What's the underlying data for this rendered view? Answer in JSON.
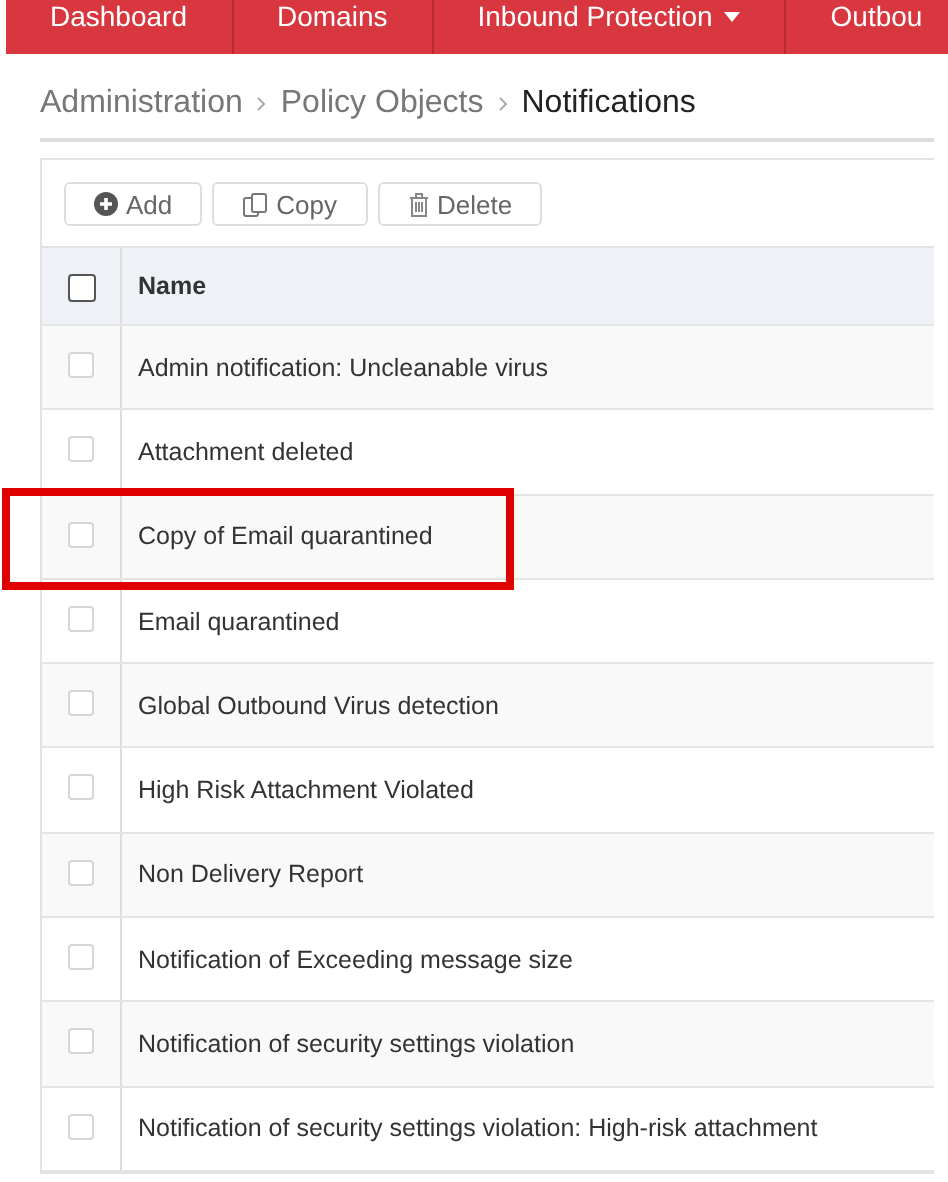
{
  "nav_tabs": [
    {
      "label": "Dashboard",
      "dropdown": false
    },
    {
      "label": "Domains",
      "dropdown": false
    },
    {
      "label": "Inbound Protection",
      "dropdown": true
    },
    {
      "label": "Outbou",
      "dropdown": false
    }
  ],
  "breadcrumb": [
    "Administration",
    "Policy Objects",
    "Notifications"
  ],
  "toolbar": [
    {
      "label": "Add",
      "kind": "add"
    },
    {
      "label": "Copy",
      "kind": "copy"
    },
    {
      "label": "Delete",
      "kind": "delete"
    }
  ],
  "table": {
    "columns": [
      "Name"
    ],
    "header_checked": false,
    "rows": [
      {
        "name": "Admin notification: Uncleanable virus",
        "checked": false,
        "highlighted": false
      },
      {
        "name": "Attachment deleted",
        "checked": false,
        "highlighted": false
      },
      {
        "name": "Copy of Email quarantined",
        "checked": false,
        "highlighted": true
      },
      {
        "name": "Email quarantined",
        "checked": false,
        "highlighted": false
      },
      {
        "name": "Global Outbound Virus detection",
        "checked": false,
        "highlighted": false
      },
      {
        "name": "High Risk Attachment Violated",
        "checked": false,
        "highlighted": false
      },
      {
        "name": "Non Delivery Report",
        "checked": false,
        "highlighted": false
      },
      {
        "name": "Notification of Exceeding message size",
        "checked": false,
        "highlighted": false
      },
      {
        "name": "Notification of security settings violation",
        "checked": false,
        "highlighted": false
      },
      {
        "name": "Notification of security settings violation: High-risk attachment",
        "checked": false,
        "highlighted": false
      }
    ]
  }
}
